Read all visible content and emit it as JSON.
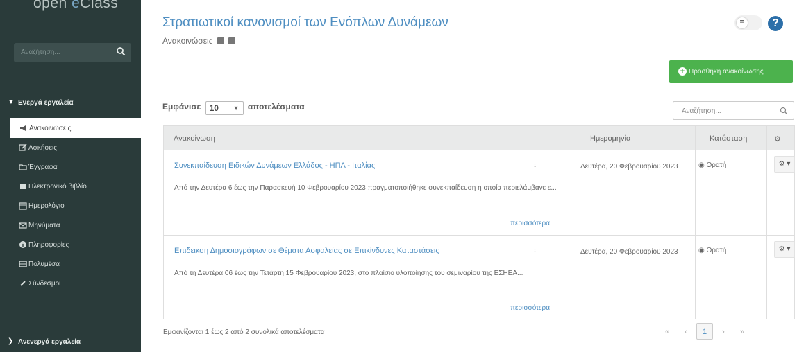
{
  "sidebar": {
    "logo_prefix": "open ",
    "logo_e": "e",
    "logo_suffix": "Class",
    "search_placeholder": "Αναζήτηση...",
    "active_section": "Ενεργά εργαλεία",
    "items": [
      {
        "label": "Ανακοινώσεις",
        "icon": "bullhorn-icon",
        "active": true
      },
      {
        "label": "Ασκήσεις",
        "icon": "edit-icon",
        "active": false
      },
      {
        "label": "Έγγραφα",
        "icon": "folder-icon",
        "active": false
      },
      {
        "label": "Ηλεκτρονικό βιβλίο",
        "icon": "book-icon",
        "active": false
      },
      {
        "label": "Ημερολόγιο",
        "icon": "calendar-icon",
        "active": false
      },
      {
        "label": "Μηνύματα",
        "icon": "envelope-icon",
        "active": false
      },
      {
        "label": "Πληροφορίες",
        "icon": "info-icon",
        "active": false
      },
      {
        "label": "Πολυμέσα",
        "icon": "film-icon",
        "active": false
      },
      {
        "label": "Σύνδεσμοι",
        "icon": "link-icon",
        "active": false
      }
    ],
    "inactive_section": "Ανενεργά εργαλεία"
  },
  "header": {
    "title": "Στρατιωτικοί κανονισμοί των Ενόπλων Δυνάμεων",
    "subtitle": "Ανακοινώσεις",
    "help": "?"
  },
  "add_button": "Προσθήκη ανακοίνωσης",
  "controls": {
    "show_label": "Εμφάνισε",
    "page_size": "10",
    "results_label": "αποτελέσματα",
    "search_placeholder": "Αναζήτηση..."
  },
  "table": {
    "columns": [
      "Ανακοίνωση",
      "Ημερομηνία",
      "Κατάσταση"
    ],
    "rows": [
      {
        "title": "Συνεκπαίδευση Ειδικών Δυνάμεων Ελλάδος - ΗΠΑ - Ιταλίας",
        "body": "Από την Δευτέρα 6 έως την Παρασκευή 10 Φεβρουαρίου 2023 πραγματοποιήθηκε συνεκπαίδευση η οποία περιελάμβανε ε...",
        "more": "περισσότερα",
        "date": "Δευτέρα, 20 Φεβρουαρίου 2023",
        "state": "Ορατή"
      },
      {
        "title": "Επιδεικση Δημοσιογράφων σε Θέματα Ασφαλείας σε Επικίνδυνες Καταστάσεις",
        "body": "Από τη Δευτέρα 06 έως την Τετάρτη 15 Φεβρουαρίου 2023, στο πλαίσιο υλοποίησης του σεμιναρίου της ΕΣΗΕΑ...",
        "more": "περισσότερα",
        "date": "Δευτέρα, 20 Φεβρουαρίου 2023",
        "state": "Ορατή"
      }
    ]
  },
  "footer": {
    "summary": "Εμφανίζονται 1 έως 2 από 2 συνολικά αποτελέσματα",
    "current_page": "1"
  }
}
